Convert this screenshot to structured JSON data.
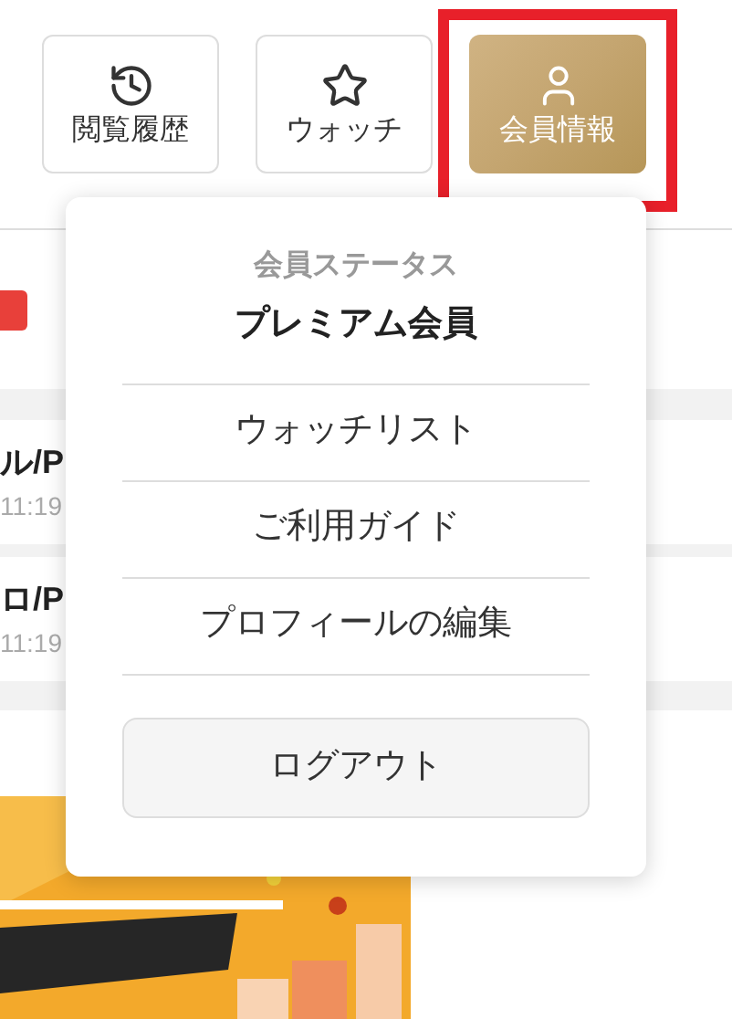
{
  "header_buttons": [
    {
      "kind": "history",
      "label": "閲覧履歴",
      "selected": false
    },
    {
      "kind": "watch",
      "label": "ウォッチ",
      "selected": false
    },
    {
      "kind": "member",
      "label": "会員情報",
      "selected": true
    }
  ],
  "list_items": [
    {
      "title": "ル/P",
      "time": "11:19"
    },
    {
      "title": "ロ/P",
      "time": "11:19"
    }
  ],
  "member_menu": {
    "status_label": "会員ステータス",
    "status": "プレミアム会員",
    "items": [
      "ウォッチリスト",
      "ご利用ガイド",
      "プロフィールの編集"
    ],
    "logout": "ログアウト"
  }
}
